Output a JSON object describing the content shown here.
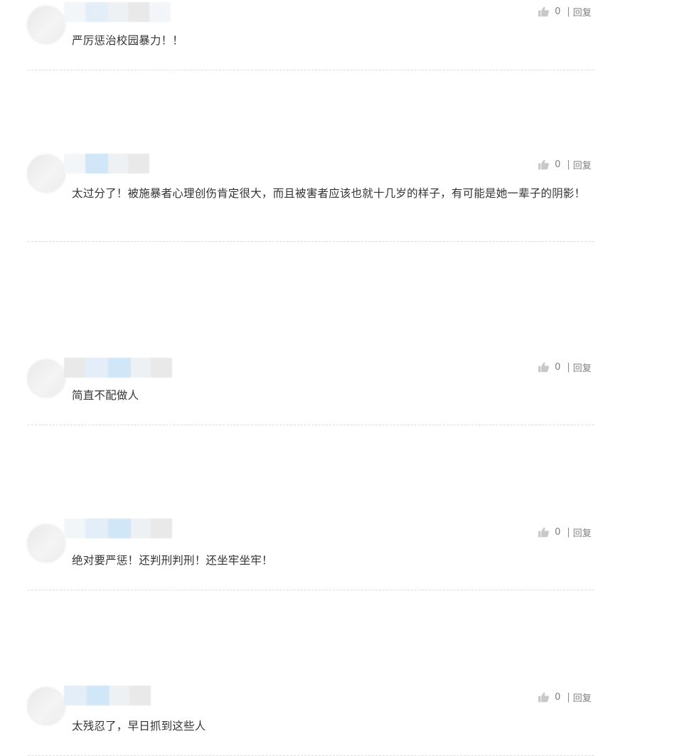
{
  "comments": [
    {
      "text": "严厉惩治校园暴力！！",
      "likes": "0",
      "separator": "|",
      "reply_label": "回复"
    },
    {
      "text": "太过分了！被施暴者心理创伤肯定很大，而且被害者应该也就十几岁的样子，有可能是她一辈子的阴影！",
      "likes": "0",
      "separator": "|",
      "reply_label": "回复"
    },
    {
      "text": "简直不配做人",
      "likes": "0",
      "separator": "|",
      "reply_label": "回复"
    },
    {
      "text": "绝对要严惩！还判刑判刑！还坐牢坐牢！",
      "likes": "0",
      "separator": "|",
      "reply_label": "回复"
    },
    {
      "text": "太残忍了，早日抓到这些人",
      "likes": "0",
      "separator": "|",
      "reply_label": "回复"
    }
  ],
  "icons": {
    "like": "thumbs-up-icon"
  },
  "colors": {
    "text": "#333333",
    "meta": "#888888",
    "icon": "#c8c8c8",
    "divider": "#dcdcdc"
  }
}
